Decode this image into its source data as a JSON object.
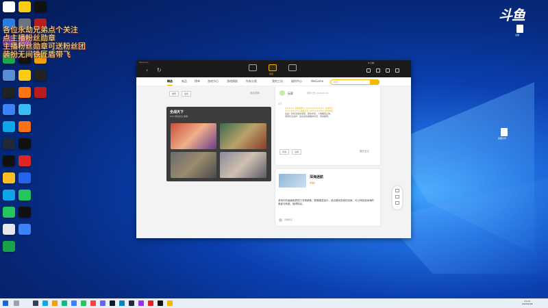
{
  "logo": "斗鱼",
  "overlay": {
    "lines": [
      "各位永劫兄弟点个关注",
      "点主播粉丝勋章",
      "主播粉丝勋章可送粉丝团",
      "装扮无间铁匠盾带飞"
    ]
  },
  "desktop_right_files": [
    {
      "label": "主播"
    },
    {
      "label": "桌面文件"
    }
  ],
  "app": {
    "window_label": "WeGame",
    "top_nav_active": "商店",
    "user_name": "Hi人物",
    "tabs": [
      "精选",
      "新品",
      "榜单",
      "游戏节日",
      "游戏情报",
      "所有分类",
      "我的工坊",
      "福利中心",
      "WeGame"
    ],
    "search_placeholder": "搜索",
    "filter_chips": [
      "推荐",
      "最新"
    ],
    "sort_label": "综合排序",
    "banner": {
      "title": "全战天下",
      "subtitle": "RPG  角色扮演  策略"
    },
    "review_user": "玩家",
    "review_meta": "游戏 已售 2024-10-10",
    "review_lines": [
      "★★★★★ 合集推荐人   ★★★★★★★★★★ 全体用户",
      "★★★★★★★★ 画面表现   ★★★★★★★★ 游戏体验",
      "这是一款有深度的游戏，剧情丰富，人物塑造立体。",
      "游戏玩法多样，适合喜欢策略的玩家，值得推荐。"
    ],
    "review_chips": [
      "有用",
      "没用"
    ],
    "review_more": "展开全文",
    "game": {
      "title": "深海迷航",
      "price": "¥98"
    },
    "game_desc": "游戏中的画面和表现力非常精美，剧情推进适中，适合喜欢探索的玩家。可以体验到深海的奥秘与刺激，值得购买。",
    "game_footer": "查看更多"
  },
  "taskbar": {
    "time": "21:21",
    "date": "2023/2/28"
  }
}
